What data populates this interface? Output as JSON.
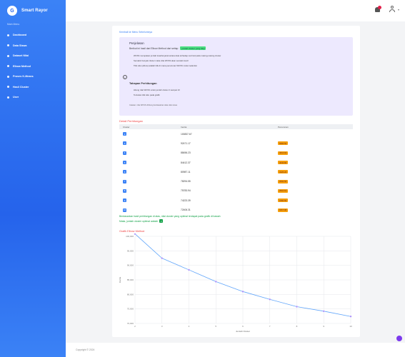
{
  "sidebar": {
    "brand_logo": "G",
    "brand_title": "Smart Rayor",
    "menu_title": "Main Menu",
    "items": [
      {
        "label": "Dashboard"
      },
      {
        "label": "Data Siswa"
      },
      {
        "label": "Dataset Nilai"
      },
      {
        "label": "Elbow Method"
      },
      {
        "label": "Proses K-Means"
      },
      {
        "label": "Hasil Cluster"
      },
      {
        "label": "User"
      }
    ]
  },
  "main": {
    "back_link": "Kembali ke Menu Sebelumnya",
    "explain": {
      "heading": "Penjelasan",
      "sub_text": "Berikut ini hasil dari Elbow Method dari setiap",
      "sub_highlight": "jumlah cluster yang diuji",
      "bullets": [
        "WCSS merupakan jumlah kuadrat jarak antara data terhadap centroid pada masing-masing cluster",
        "Semakin banyak cluster maka nilai WCSS akan semakin kecil",
        "Titik siku (elbow) adalah titik di mana penurunan WCSS mulai melandai"
      ],
      "steps_heading": "Tahapan Perhitungan",
      "steps": [
        "Hitung nilai WCSS untuk jumlah cluster 2 sampai 10",
        "Tentukan titik siku pada grafik"
      ],
      "note": "Catatan: nilai WCSS dihitung berdasarkan data nilai siswa"
    },
    "calc_title": "Detail Perhitungan",
    "table": {
      "headers": [
        "Cluster",
        "Inertia",
        "Penurunan"
      ],
      "rows": [
        {
          "cluster": "2",
          "inertia": "100837.67",
          "drop": ""
        },
        {
          "cluster": "3",
          "inertia": "92471.17",
          "drop": "8366.50"
        },
        {
          "cluster": "4",
          "inertia": "88456.23",
          "drop": "4014.94"
        },
        {
          "cluster": "5",
          "inertia": "84412.37",
          "drop": "4043.86"
        },
        {
          "cluster": "6",
          "inertia": "80987.11",
          "drop": "3425.26"
        },
        {
          "cluster": "7",
          "inertia": "78294.55",
          "drop": "2692.56"
        },
        {
          "cluster": "8",
          "inertia": "75783.94",
          "drop": "2510.61"
        },
        {
          "cluster": "9",
          "inertia": "74223.39",
          "drop": "1560.55"
        },
        {
          "cluster": "10",
          "inertia": "72406.31",
          "drop": "1817.08"
        }
      ]
    },
    "result_line1": "Berdasarkan hasil perhitungan di atas, nilai cluster yang optimal terdapat pada grafik di bawah",
    "result_line2": "Maka, jumlah cluster optimal adalah",
    "result_k": "3",
    "chart_title": "Grafik Elbow Method"
  },
  "chart_data": {
    "type": "line",
    "title": "Grafik Elbow Method",
    "xlabel": "Jumlah Cluster",
    "ylabel": "Inertia",
    "x": [
      2,
      3,
      4,
      5,
      6,
      7,
      8,
      9,
      10
    ],
    "y": [
      100837.67,
      92471.17,
      88456.23,
      84412.37,
      80987.11,
      78294.55,
      75783.94,
      74223.39,
      72406.31
    ],
    "xlim": [
      2,
      10
    ],
    "ylim": [
      70000,
      100000
    ],
    "yticks": [
      70000,
      75000,
      80000,
      85000,
      90000,
      95000,
      100000
    ],
    "ytick_labels": [
      "70,000",
      "75,000",
      "80,000",
      "85,000",
      "90,000",
      "95,000",
      "100,000"
    ],
    "xticks": [
      2,
      3,
      4,
      5,
      6,
      7,
      8,
      9,
      10
    ],
    "grid": true,
    "line_color": "#60a5fa",
    "point_color": "#a78bfa"
  },
  "footer": {
    "copyright": "Copyright © 2024"
  },
  "colors": {
    "sidebar": "#2563eb",
    "accent": "#3b82f6",
    "highlight": "#4ade80",
    "badge": "#f59e0b"
  }
}
